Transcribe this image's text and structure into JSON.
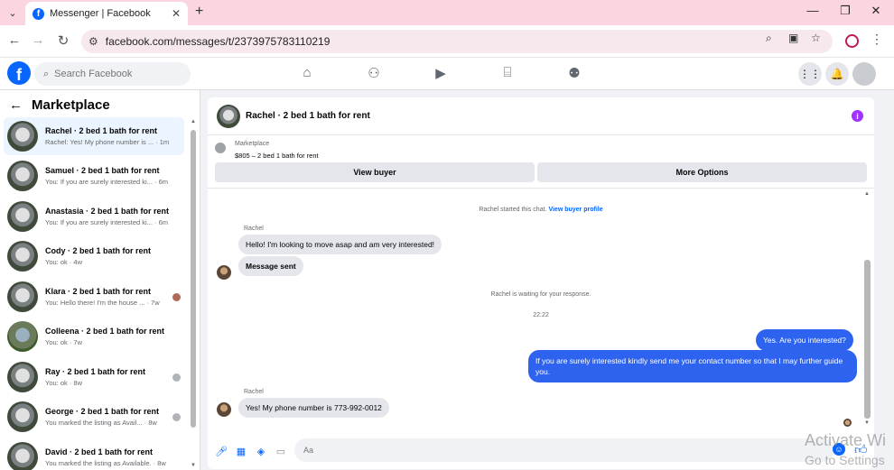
{
  "browser": {
    "tab_title": "Messenger | Facebook",
    "tab_close": "✕",
    "new_tab": "+",
    "url": "facebook.com/messages/t/2373975783110219",
    "win_min": "—",
    "win_max": "❐",
    "win_close": "✕"
  },
  "fb": {
    "logo": "f",
    "search_placeholder": "Search Facebook",
    "nav_icons": [
      "home-icon",
      "friends-icon",
      "watch-icon",
      "marketplace-icon",
      "groups-icon"
    ],
    "accent": "#0866ff"
  },
  "left": {
    "title": "Marketplace",
    "conversations": [
      {
        "name": "Rachel · 2 bed 1 bath for rent",
        "preview": "Rachel: Yes! My phone number is ... · 1m"
      },
      {
        "name": "Samuel · 2 bed 1 bath for rent",
        "preview": "You: If you are surely interested ki... · 6m"
      },
      {
        "name": "Anastasia · 2 bed 1 bath for rent",
        "preview": "You: If you are surely interested ki... · 6m"
      },
      {
        "name": "Cody · 2 bed 1 bath for rent",
        "preview": "You: ok · 4w"
      },
      {
        "name": "Klara · 2 bed 1 bath for rent",
        "preview": "You: Hello there! I'm the house ... · 7w"
      },
      {
        "name": "Colleena · 2 bed 1 bath for rent",
        "preview": "You: ok · 7w"
      },
      {
        "name": "Ray · 2 bed 1 bath for rent",
        "preview": "You: ok · 8w"
      },
      {
        "name": "George · 2 bed 1 bath for rent",
        "preview": "You marked the listing as Avail... · 8w"
      },
      {
        "name": "David · 2 bed 1 bath for rent",
        "preview": "You marked the listing as Available. · 8w"
      }
    ]
  },
  "chat": {
    "title": "Rachel · 2 bed 1 bath for rent",
    "listing_category": "Marketplace",
    "listing_price": "$805 – 2 bed 1 bath for rent",
    "view_buyer": "View buyer",
    "more_options": "More Options",
    "started_text": "Rachel started this chat.",
    "view_profile": "View buyer profile",
    "sender1": "Rachel",
    "msg1": "Hello! I'm looking to move asap and am very interested!",
    "msg2": "Message sent",
    "waiting": "Rachel is waiting for your response.",
    "time": "22:22",
    "out1": "Yes. Are you interested?",
    "out2": "If you are surely interested kindly send me your contact number so that I may further guide you.",
    "sender2": "Rachel",
    "msg3": "Yes! My phone number is 773-992-0012",
    "composer_placeholder": "Aa",
    "outgoing_color": "#2e63f0"
  },
  "watermark": {
    "line1": "Activate Wi",
    "line2": "Go to Settings"
  }
}
